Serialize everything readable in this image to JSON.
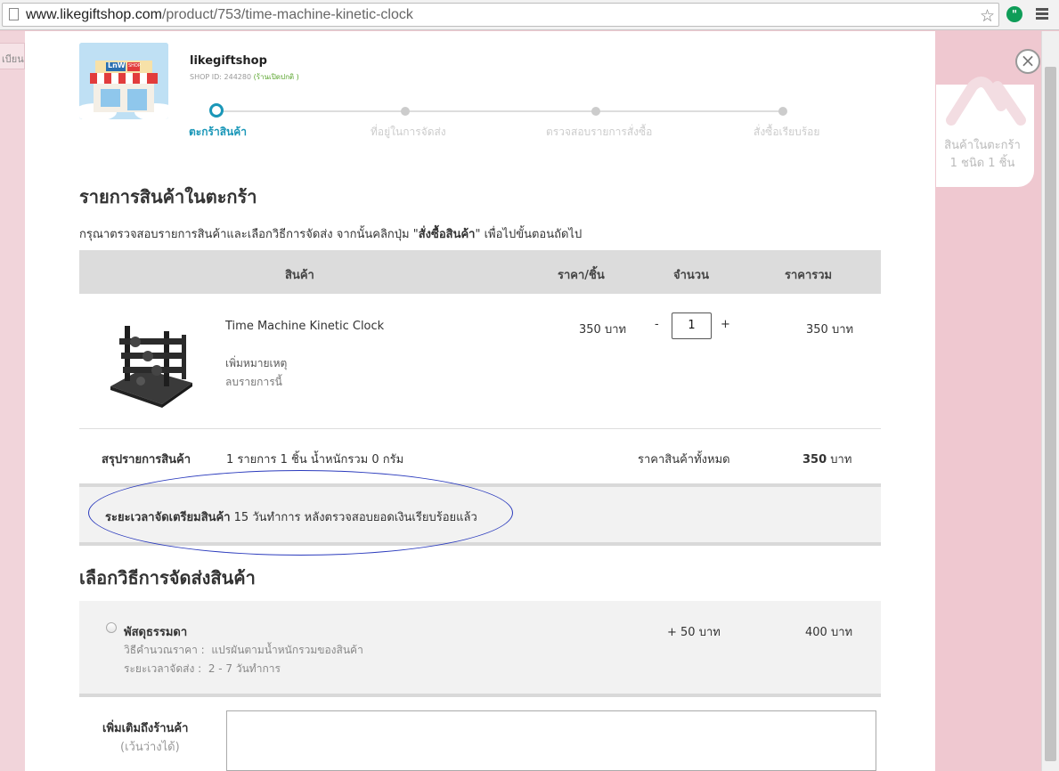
{
  "browser": {
    "url_host": "www.likegiftshop.com",
    "url_path": "/product/753/time-machine-kinetic-clock"
  },
  "background": {
    "left_tab_text": "เบียน"
  },
  "cart_widget": {
    "line1": "สินค้าในตะกร้า",
    "line2": "1 ชนิด 1 ชิ้น"
  },
  "shop": {
    "name": "likegiftshop",
    "id_label": "SHOP ID: 244280",
    "status": "(ร้านเปิดปกติ )",
    "logo_text": "LnW",
    "logo_badge": "SHOP"
  },
  "steps": [
    {
      "label": "ตะกร้าสินค้า",
      "active": true
    },
    {
      "label": "ที่อยู่ในการจัดส่ง",
      "active": false
    },
    {
      "label": "ตรวจสอบรายการสั่งซื้อ",
      "active": false
    },
    {
      "label": "สั่งซื้อเรียบร้อย",
      "active": false
    }
  ],
  "cart": {
    "title": "รายการสินค้าในตะกร้า",
    "instruction_pre": "กรุณาตรวจสอบรายการสินค้าและเลือกวิธีการจัดส่ง จากนั้นคลิกปุ่ม \"",
    "instruction_bold": "สั่งซื้อสินค้า",
    "instruction_post": "\" เพื่อไปขั้นตอนถัดไป",
    "headers": {
      "product": "สินค้า",
      "unit_price": "ราคา/ชิ้น",
      "qty": "จำนวน",
      "total": "ราคารวม"
    },
    "item": {
      "name": "Time Machine Kinetic Clock",
      "unit_price": "350 บาท",
      "qty_minus": "-",
      "qty": "1",
      "qty_plus": "+",
      "total": "350 บาท",
      "add_note": "เพิ่มหมายเหตุ",
      "remove": "ลบรายการนี้"
    },
    "summary": {
      "label": "สรุปรายการสินค้า",
      "detail": "1 รายการ 1 ชิ้น น้ำหนักรวม 0 กรัม",
      "total_label": "ราคาสินค้าทั้งหมด",
      "total_value": "350",
      "total_unit": "บาท"
    },
    "prep": {
      "label": "ระยะเวลาจัดเตรียมสินค้า",
      "text": "15 วันทำการ หลังตรวจสอบยอดเงินเรียบร้อยแล้ว"
    }
  },
  "shipping": {
    "title": "เลือกวิธีการจัดส่งสินค้า",
    "option": {
      "name": "พัสดุธรรมดา",
      "calc_label": "วิธีคำนวณราคา :",
      "calc_value": "แปรผันตามน้ำหนักรวมของสินค้า",
      "time_label": "ระยะเวลาจัดส่ง :",
      "time_value": "2 - 7 วันทำการ",
      "extra": "+ 50 บาท",
      "total": "400 บาท"
    }
  },
  "note": {
    "label": "เพิ่มเติมถึงร้านค้า",
    "sublabel": "(เว้นว่างได้)"
  }
}
